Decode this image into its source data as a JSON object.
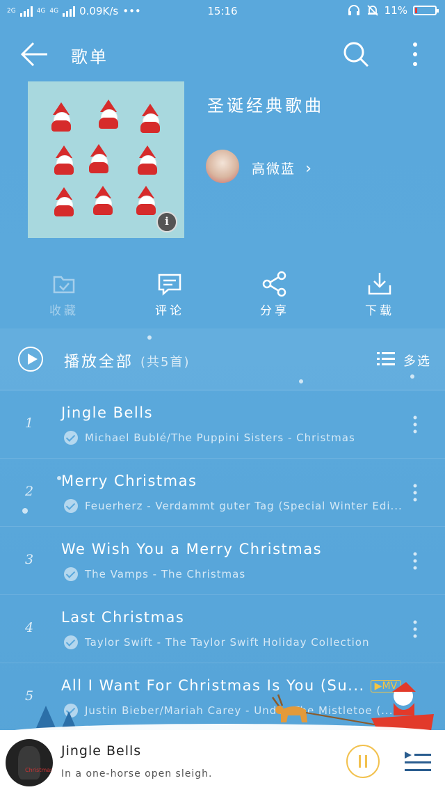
{
  "status_bar": {
    "net_type_1": "2G",
    "net_type_2": "4G",
    "net_type_3": "4G",
    "speed": "0.09K/s",
    "dots": "•••",
    "time": "15:16",
    "battery": "11%",
    "battery_level": 0.11,
    "battery_color": "#e53935"
  },
  "header": {
    "title": "歌单",
    "back_icon": "arrow-left-icon",
    "search_icon": "search-icon",
    "more_icon": "more-vertical-icon"
  },
  "playlist": {
    "name": "圣诞经典歌曲",
    "creator": "高微蓝",
    "creator_chevron": "›",
    "cover_info": "i"
  },
  "actions": [
    {
      "label": "收藏",
      "icon": "folder-check-icon",
      "enabled": false
    },
    {
      "label": "评论",
      "icon": "comment-icon",
      "enabled": true
    },
    {
      "label": "分享",
      "icon": "share-icon",
      "enabled": true
    },
    {
      "label": "下载",
      "icon": "download-icon",
      "enabled": true
    }
  ],
  "play_all": {
    "label": "播放全部",
    "count": "(共5首)",
    "multi_select": "多选"
  },
  "songs": [
    {
      "num": "1",
      "title": "Jingle Bells",
      "meta": "Michael Bublé/The Puppini Sisters - Christmas",
      "mv": ""
    },
    {
      "num": "2",
      "title": "Merry Christmas",
      "meta": "Feuerherz - Verdammt guter Tag (Special Winter Edi...",
      "mv": ""
    },
    {
      "num": "3",
      "title": "We Wish You a Merry Christmas",
      "meta": "The Vamps - The Christmas",
      "mv": ""
    },
    {
      "num": "4",
      "title": "Last Christmas",
      "meta": "Taylor Swift - The Taylor Swift Holiday Collection",
      "mv": ""
    },
    {
      "num": "5",
      "title": "All I Want For Christmas Is You (Su...",
      "meta": "Justin Bieber/Mariah Carey - Under The Mistletoe (...",
      "mv": "▶MV"
    }
  ],
  "mini_player": {
    "title": "Jingle Bells",
    "lyric": "In a one-horse open sleigh.",
    "cover_text": "Christmas",
    "accent": "#f2c14e"
  },
  "colors": {
    "background": "#5aa8dc",
    "mv_badge": "#f5c542"
  }
}
